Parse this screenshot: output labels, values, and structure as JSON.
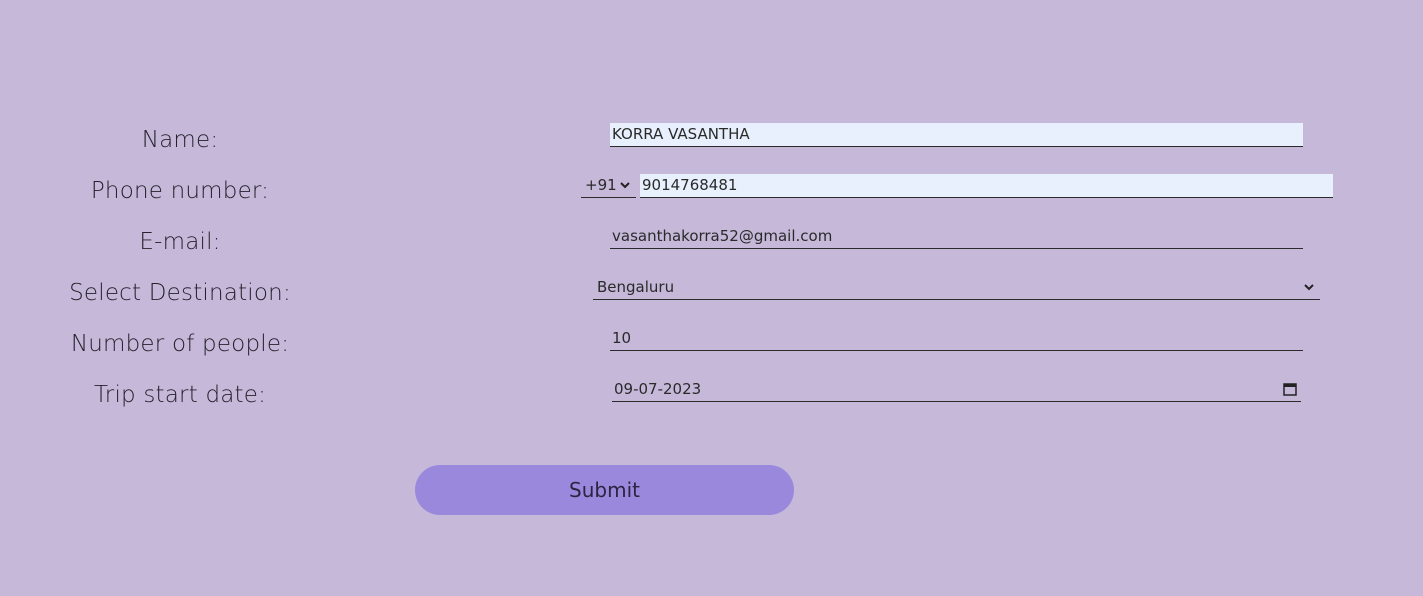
{
  "form": {
    "name": {
      "label": "Name:",
      "value": "KORRA VASANTHA"
    },
    "phone": {
      "label": "Phone number:",
      "country_code": "+91",
      "value": "9014768481"
    },
    "email": {
      "label": "E-mail:",
      "value": "vasanthakorra52@gmail.com"
    },
    "destination": {
      "label": "Select Destination:",
      "value": "Bengaluru"
    },
    "people": {
      "label": "Number of people:",
      "value": "10"
    },
    "start_date": {
      "label": "Trip start date:",
      "value": "09-07-2023"
    },
    "submit_label": "Submit"
  }
}
